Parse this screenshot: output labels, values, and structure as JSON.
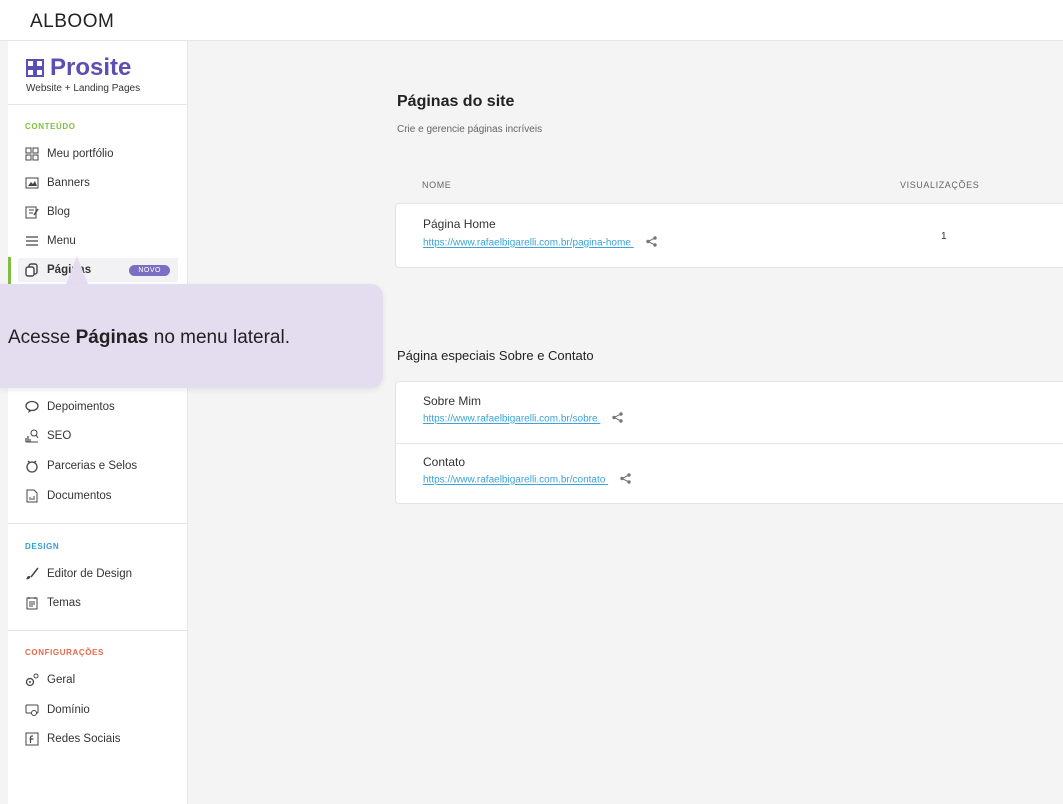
{
  "topbar": {
    "logo": "ALBOOM"
  },
  "brand": {
    "title": "Prosite",
    "subtitle": "Website + Landing Pages",
    "color": "#5b4fb3"
  },
  "sidebar": {
    "sections": {
      "conteudo": {
        "label": "CONTEÚDO",
        "color": "#7fbf3f"
      },
      "design": {
        "label": "DESIGN",
        "color": "#2f9fd8"
      },
      "config": {
        "label": "CONFIGURAÇÕES",
        "color": "#e8684a"
      }
    },
    "items": {
      "portfolio": {
        "label": "Meu portfólio",
        "icon": "grid-icon"
      },
      "banners": {
        "label": "Banners",
        "icon": "image-icon"
      },
      "blog": {
        "label": "Blog",
        "icon": "edit-icon"
      },
      "menu": {
        "label": "Menu",
        "icon": "menu-icon"
      },
      "paginas": {
        "label": "Páginas",
        "icon": "pages-icon",
        "badge": "NOVO"
      },
      "depoimentos": {
        "label": "Depoimentos",
        "icon": "chat-icon"
      },
      "seo": {
        "label": "SEO",
        "icon": "seo-icon"
      },
      "parcerias": {
        "label": "Parcerias e Selos",
        "icon": "seal-icon"
      },
      "documentos": {
        "label": "Documentos",
        "icon": "document-icon"
      },
      "editor": {
        "label": "Editor de Design",
        "icon": "brush-icon"
      },
      "temas": {
        "label": "Temas",
        "icon": "theme-icon"
      },
      "geral": {
        "label": "Geral",
        "icon": "gear-icon"
      },
      "dominio": {
        "label": "Domínio",
        "icon": "domain-icon"
      },
      "redes": {
        "label": "Redes Sociais",
        "icon": "social-icon"
      }
    }
  },
  "tooltip": {
    "prefix": "Acesse ",
    "bold": "Páginas",
    "suffix": " no menu lateral."
  },
  "main": {
    "title": "Páginas do site",
    "subtitle": "Crie e gerencie páginas incríveis",
    "columns": {
      "name": "NOME",
      "views": "VISUALIZAÇÕES"
    },
    "pages": [
      {
        "name": "Página Home",
        "url": "https://www.rafaelbigarelli.com.br/pagina-home",
        "views": "1"
      }
    ],
    "special_title": "Página especiais Sobre e Contato",
    "special_pages": [
      {
        "name": "Sobre Mim",
        "url": "https://www.rafaelbigarelli.com.br/sobre"
      },
      {
        "name": "Contato",
        "url": "https://www.rafaelbigarelli.com.br/contato"
      }
    ]
  }
}
